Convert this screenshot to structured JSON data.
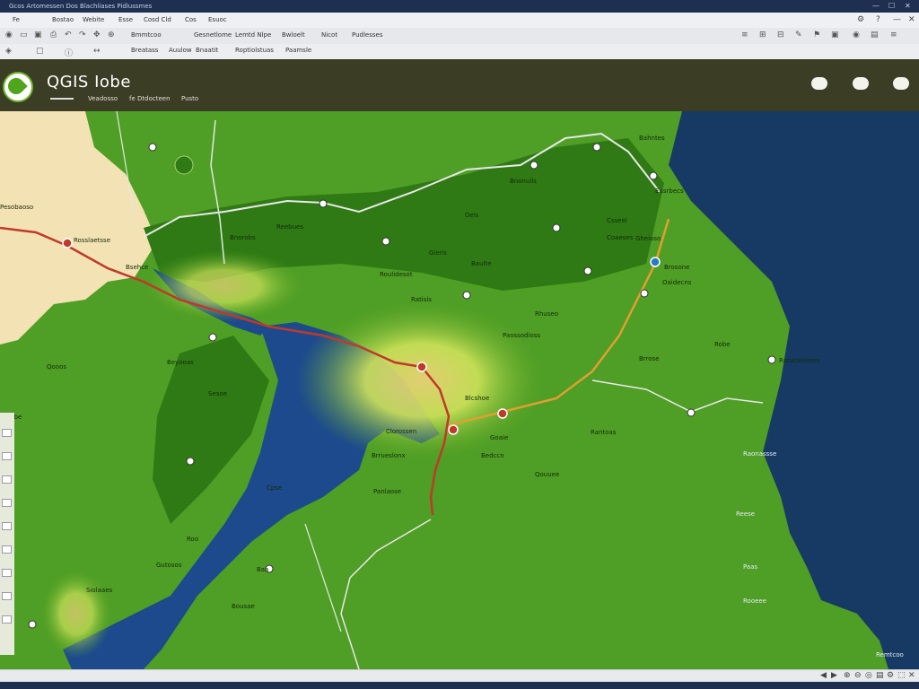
{
  "window": {
    "title": "Gcos Artomessen   Dos Blachliases Pidlussmes",
    "controls": [
      "—",
      "☐",
      "✕"
    ]
  },
  "menu": {
    "items": [
      "Fe",
      "Bostao",
      "Webite",
      "Esse",
      "Cosd Cld",
      "Cos",
      "Esuoc"
    ],
    "right_icons": [
      "gear-icon",
      "help-icon",
      "minimize-icon",
      "close-icon"
    ]
  },
  "toolbar": {
    "items": [
      "Bmmtcoo",
      "Gesnetlome",
      "Lemtd Nlpe",
      "Bwloelt",
      "Nicot",
      "Pudlesses"
    ],
    "right_icons": [
      "≡",
      "⊞",
      "⊟",
      "✎",
      "⚑",
      "▣",
      "◉",
      "▤",
      "≡"
    ]
  },
  "toolbar2": {
    "items": [
      "Breatass",
      "Auulow",
      "Bnaatit",
      "Roptiolstuas",
      "Paamsle"
    ]
  },
  "header": {
    "app_title": "QGIS Iobe",
    "nav": [
      "Veadosso",
      "fe Dtdocteen",
      "Pusto"
    ]
  },
  "map": {
    "labels": [
      {
        "t": "Pesobaoso",
        "cls": ""
      },
      {
        "t": "Rosslaetsse",
        "cls": ""
      },
      {
        "t": "Bsehce",
        "cls": ""
      },
      {
        "t": "Bnorobs",
        "cls": ""
      },
      {
        "t": "Reebues",
        "cls": ""
      },
      {
        "t": "Giens",
        "cls": ""
      },
      {
        "t": "Oeis",
        "cls": ""
      },
      {
        "t": "Bnonulls",
        "cls": ""
      },
      {
        "t": "Baulte",
        "cls": ""
      },
      {
        "t": "Csseel",
        "cls": ""
      },
      {
        "t": "Coaeses",
        "cls": ""
      },
      {
        "t": "Bahntes",
        "cls": ""
      },
      {
        "t": "Eusrbecs",
        "cls": ""
      },
      {
        "t": "Gheioso",
        "cls": ""
      },
      {
        "t": "Brosone",
        "cls": ""
      },
      {
        "t": "Oaidecns",
        "cls": ""
      },
      {
        "t": "Roulidesot",
        "cls": ""
      },
      {
        "t": "Ratisis",
        "cls": ""
      },
      {
        "t": "Qooos",
        "cls": ""
      },
      {
        "t": "Beyooas",
        "cls": ""
      },
      {
        "t": "Paossodioss",
        "cls": ""
      },
      {
        "t": "Rhuseo",
        "cls": ""
      },
      {
        "t": "Blcshoe",
        "cls": ""
      },
      {
        "t": "Clorossen",
        "cls": ""
      },
      {
        "t": "Goaie",
        "cls": ""
      },
      {
        "t": "Bedccn",
        "cls": ""
      },
      {
        "t": "Rantoas",
        "cls": ""
      },
      {
        "t": "Robe",
        "cls": ""
      },
      {
        "t": "Brrose",
        "cls": ""
      },
      {
        "t": "Rasatalesses",
        "cls": ""
      },
      {
        "t": "Qouuee",
        "cls": ""
      },
      {
        "t": "Sesoe",
        "cls": ""
      },
      {
        "t": "Brrueslonx",
        "cls": ""
      },
      {
        "t": "Cpse",
        "cls": ""
      },
      {
        "t": "Panlaose",
        "cls": ""
      },
      {
        "t": "Gutosos",
        "cls": ""
      },
      {
        "t": "Bousae",
        "cls": ""
      },
      {
        "t": "Raonassse",
        "cls": "sea"
      },
      {
        "t": "Reese",
        "cls": "sea"
      },
      {
        "t": "Paas",
        "cls": "sea"
      },
      {
        "t": "Rooeee",
        "cls": "sea"
      },
      {
        "t": "Remtcoo",
        "cls": "sea"
      },
      {
        "t": "Roo",
        "cls": ""
      },
      {
        "t": "Baa",
        "cls": ""
      },
      {
        "t": "Siolaaes",
        "cls": ""
      },
      {
        "t": "Qibe",
        "cls": ""
      }
    ]
  },
  "status": {
    "right_icons": [
      "◀",
      "▶",
      "⊕",
      "⊖",
      "◎",
      "▤",
      "⚙",
      "⬚",
      "✕"
    ]
  },
  "colors": {
    "land": "#4f9e25",
    "land_dark": "#2f7a14",
    "sea": "#163a64",
    "lake": "#1d4a8c",
    "sand": "#f3e2b3",
    "road_major": "#c0392b",
    "road_minor": "#e8e8e8",
    "highway": "#e0a030",
    "header_bg": "#3b3d25"
  }
}
